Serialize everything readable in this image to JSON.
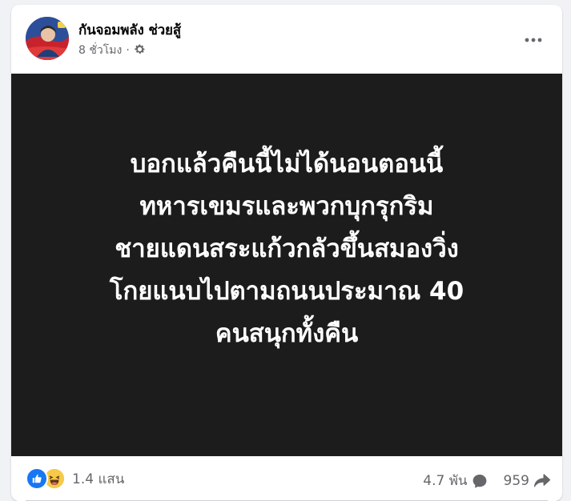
{
  "post": {
    "author": "กันจอมพลัง ช่วยสู้",
    "time": "8 ชั่วโมง",
    "separator": "·",
    "privacy_icon": "gear-icon",
    "more_icon": "more-options-icon",
    "media_lines": [
      "บอกแล้วคืนนี้ไม่ได้นอนตอนนี้",
      "ทหารเขมรและพวกบุกรุกริม",
      "ชายแดนสระแก้วกลัวขึ้นสมองวิ่ง",
      "โกยแนบไปตามถนนประมาณ 40",
      "คนสนุกทั้งคืน"
    ]
  },
  "footer": {
    "reaction_icons": [
      "like-icon",
      "haha-icon"
    ],
    "reaction_count": "1.4 แสน",
    "comment_count": "4.7 พัน",
    "comment_icon": "comment-icon",
    "share_count": "959",
    "share_icon": "share-icon"
  },
  "colors": {
    "background": "#f0f2f5",
    "card": "#ffffff",
    "media_bg": "#1c1c1c",
    "like_blue": "#1877f2",
    "haha_yellow": "#f7c949",
    "secondary_text": "#65676b"
  }
}
